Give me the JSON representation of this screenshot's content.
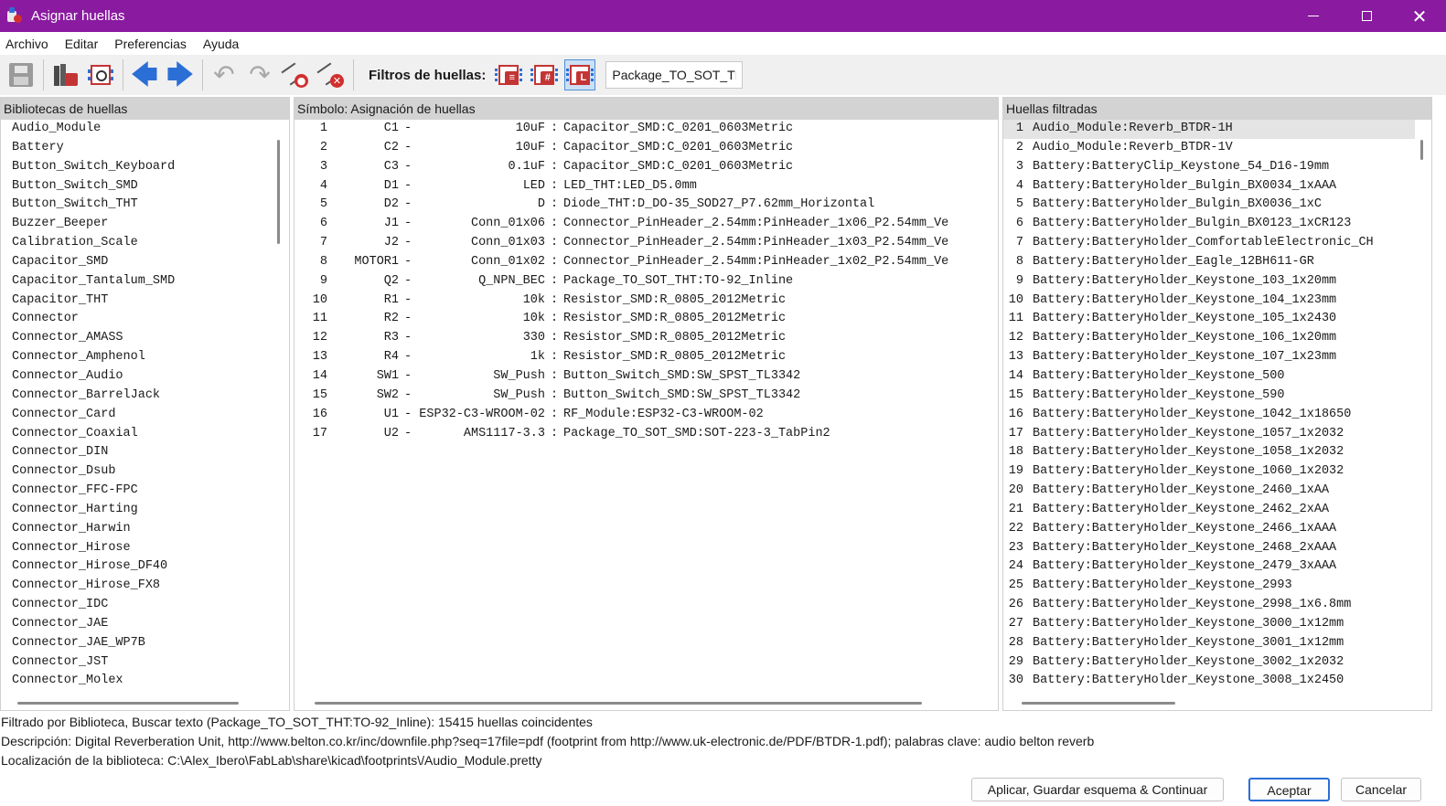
{
  "window": {
    "title": "Asignar huellas"
  },
  "menu": [
    "Archivo",
    "Editar",
    "Preferencias",
    "Ayuda"
  ],
  "toolbar": {
    "filters_label": "Filtros de huellas:",
    "filter_text": "Package_TO_SOT_THT"
  },
  "libraries": {
    "header": "Bibliotecas de huellas",
    "items": [
      "Audio_Module",
      "Battery",
      "Button_Switch_Keyboard",
      "Button_Switch_SMD",
      "Button_Switch_THT",
      "Buzzer_Beeper",
      "Calibration_Scale",
      "Capacitor_SMD",
      "Capacitor_Tantalum_SMD",
      "Capacitor_THT",
      "Connector",
      "Connector_AMASS",
      "Connector_Amphenol",
      "Connector_Audio",
      "Connector_BarrelJack",
      "Connector_Card",
      "Connector_Coaxial",
      "Connector_DIN",
      "Connector_Dsub",
      "Connector_FFC-FPC",
      "Connector_Harting",
      "Connector_Harwin",
      "Connector_Hirose",
      "Connector_Hirose_DF40",
      "Connector_Hirose_FX8",
      "Connector_IDC",
      "Connector_JAE",
      "Connector_JAE_WP7B",
      "Connector_JST",
      "Connector_Molex"
    ]
  },
  "symbols": {
    "header": "Símbolo: Asignación de huellas",
    "rows": [
      {
        "i": "1",
        "ref": "C1",
        "val": "10uF",
        "fp": "Capacitor_SMD:C_0201_0603Metric"
      },
      {
        "i": "2",
        "ref": "C2",
        "val": "10uF",
        "fp": "Capacitor_SMD:C_0201_0603Metric"
      },
      {
        "i": "3",
        "ref": "C3",
        "val": "0.1uF",
        "fp": "Capacitor_SMD:C_0201_0603Metric"
      },
      {
        "i": "4",
        "ref": "D1",
        "val": "LED",
        "fp": "LED_THT:LED_D5.0mm"
      },
      {
        "i": "5",
        "ref": "D2",
        "val": "D",
        "fp": "Diode_THT:D_DO-35_SOD27_P7.62mm_Horizontal"
      },
      {
        "i": "6",
        "ref": "J1",
        "val": "Conn_01x06",
        "fp": "Connector_PinHeader_2.54mm:PinHeader_1x06_P2.54mm_Ve"
      },
      {
        "i": "7",
        "ref": "J2",
        "val": "Conn_01x03",
        "fp": "Connector_PinHeader_2.54mm:PinHeader_1x03_P2.54mm_Ve"
      },
      {
        "i": "8",
        "ref": "MOTOR1",
        "val": "Conn_01x02",
        "fp": "Connector_PinHeader_2.54mm:PinHeader_1x02_P2.54mm_Ve"
      },
      {
        "i": "9",
        "ref": "Q2",
        "val": "Q_NPN_BEC",
        "fp": "Package_TO_SOT_THT:TO-92_Inline"
      },
      {
        "i": "10",
        "ref": "R1",
        "val": "10k",
        "fp": "Resistor_SMD:R_0805_2012Metric"
      },
      {
        "i": "11",
        "ref": "R2",
        "val": "10k",
        "fp": "Resistor_SMD:R_0805_2012Metric"
      },
      {
        "i": "12",
        "ref": "R3",
        "val": "330",
        "fp": "Resistor_SMD:R_0805_2012Metric"
      },
      {
        "i": "13",
        "ref": "R4",
        "val": "1k",
        "fp": "Resistor_SMD:R_0805_2012Metric"
      },
      {
        "i": "14",
        "ref": "SW1",
        "val": "SW_Push",
        "fp": "Button_Switch_SMD:SW_SPST_TL3342"
      },
      {
        "i": "15",
        "ref": "SW2",
        "val": "SW_Push",
        "fp": "Button_Switch_SMD:SW_SPST_TL3342"
      },
      {
        "i": "16",
        "ref": "U1",
        "val": "ESP32-C3-WROOM-02",
        "fp": "RF_Module:ESP32-C3-WROOM-02"
      },
      {
        "i": "17",
        "ref": "U2",
        "val": "AMS1117-3.3",
        "fp": "Package_TO_SOT_SMD:SOT-223-3_TabPin2"
      }
    ]
  },
  "footprints": {
    "header": "Huellas filtradas",
    "items": [
      "Audio_Module:Reverb_BTDR-1H",
      "Audio_Module:Reverb_BTDR-1V",
      "Battery:BatteryClip_Keystone_54_D16-19mm",
      "Battery:BatteryHolder_Bulgin_BX0034_1xAAA",
      "Battery:BatteryHolder_Bulgin_BX0036_1xC",
      "Battery:BatteryHolder_Bulgin_BX0123_1xCR123",
      "Battery:BatteryHolder_ComfortableElectronic_CH",
      "Battery:BatteryHolder_Eagle_12BH611-GR",
      "Battery:BatteryHolder_Keystone_103_1x20mm",
      "Battery:BatteryHolder_Keystone_104_1x23mm",
      "Battery:BatteryHolder_Keystone_105_1x2430",
      "Battery:BatteryHolder_Keystone_106_1x20mm",
      "Battery:BatteryHolder_Keystone_107_1x23mm",
      "Battery:BatteryHolder_Keystone_500",
      "Battery:BatteryHolder_Keystone_590",
      "Battery:BatteryHolder_Keystone_1042_1x18650",
      "Battery:BatteryHolder_Keystone_1057_1x2032",
      "Battery:BatteryHolder_Keystone_1058_1x2032",
      "Battery:BatteryHolder_Keystone_1060_1x2032",
      "Battery:BatteryHolder_Keystone_2460_1xAA",
      "Battery:BatteryHolder_Keystone_2462_2xAA",
      "Battery:BatteryHolder_Keystone_2466_1xAAA",
      "Battery:BatteryHolder_Keystone_2468_2xAAA",
      "Battery:BatteryHolder_Keystone_2479_3xAAA",
      "Battery:BatteryHolder_Keystone_2993",
      "Battery:BatteryHolder_Keystone_2998_1x6.8mm",
      "Battery:BatteryHolder_Keystone_3000_1x12mm",
      "Battery:BatteryHolder_Keystone_3001_1x12mm",
      "Battery:BatteryHolder_Keystone_3002_1x2032",
      "Battery:BatteryHolder_Keystone_3008_1x2450"
    ]
  },
  "status": {
    "filter": "Filtrado por Biblioteca, Buscar texto (Package_TO_SOT_THT:TO-92_Inline): 15415 huellas coincidentes",
    "description": "Descripción: Digital Reverberation Unit, http://www.belton.co.kr/inc/downfile.php?seq=17file=pdf (footprint from http://www.uk-electronic.de/PDF/BTDR-1.pdf);  palabras clave: audio belton reverb",
    "location": "Localización de la biblioteca: C:\\Alex_Ibero\\FabLab\\share\\kicad\\footprints\\/Audio_Module.pretty"
  },
  "buttons": {
    "apply": "Aplicar, Guardar esquema & Continuar",
    "ok": "Aceptar",
    "cancel": "Cancelar"
  },
  "colors": {
    "titlebar": "#8a1aa0",
    "accent": "#2b6fd6",
    "header": "#d3d3d3"
  }
}
